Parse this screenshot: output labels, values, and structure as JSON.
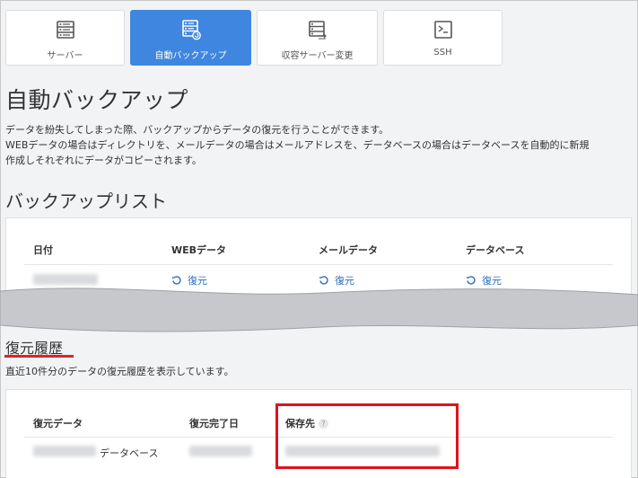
{
  "tabs": [
    {
      "label": "サーバー",
      "icon": "server-list-icon",
      "active": false
    },
    {
      "label": "自動バックアップ",
      "icon": "backup-icon",
      "active": true
    },
    {
      "label": "収容サーバー変更",
      "icon": "server-move-icon",
      "active": false
    },
    {
      "label": "SSH",
      "icon": "terminal-icon",
      "active": false
    }
  ],
  "page": {
    "title": "自動バックアップ",
    "desc_line1": "データを紛失してしまった際、バックアップからデータの復元を行うことができます。",
    "desc_line2": "WEBデータの場合はディレクトリを、メールデータの場合はメールアドレスを、データベースの場合はデータベースを自動的に新規",
    "desc_line3": "作成しそれぞれにデータがコピーされます。"
  },
  "backup_list": {
    "title": "バックアップリスト",
    "columns": [
      "日付",
      "WEBデータ",
      "メールデータ",
      "データベース"
    ],
    "row": {
      "restore_label": "復元"
    }
  },
  "history": {
    "title": "復元履歴",
    "desc": "直近10件分のデータの復元履歴を表示しています。",
    "columns": [
      "復元データ",
      "復元完了日",
      "保存先"
    ],
    "help_mark": "?",
    "row": {
      "type": "データベース"
    }
  },
  "colors": {
    "accent": "#3f86e0",
    "link": "#2c6dbf",
    "highlight": "#e0121b"
  }
}
